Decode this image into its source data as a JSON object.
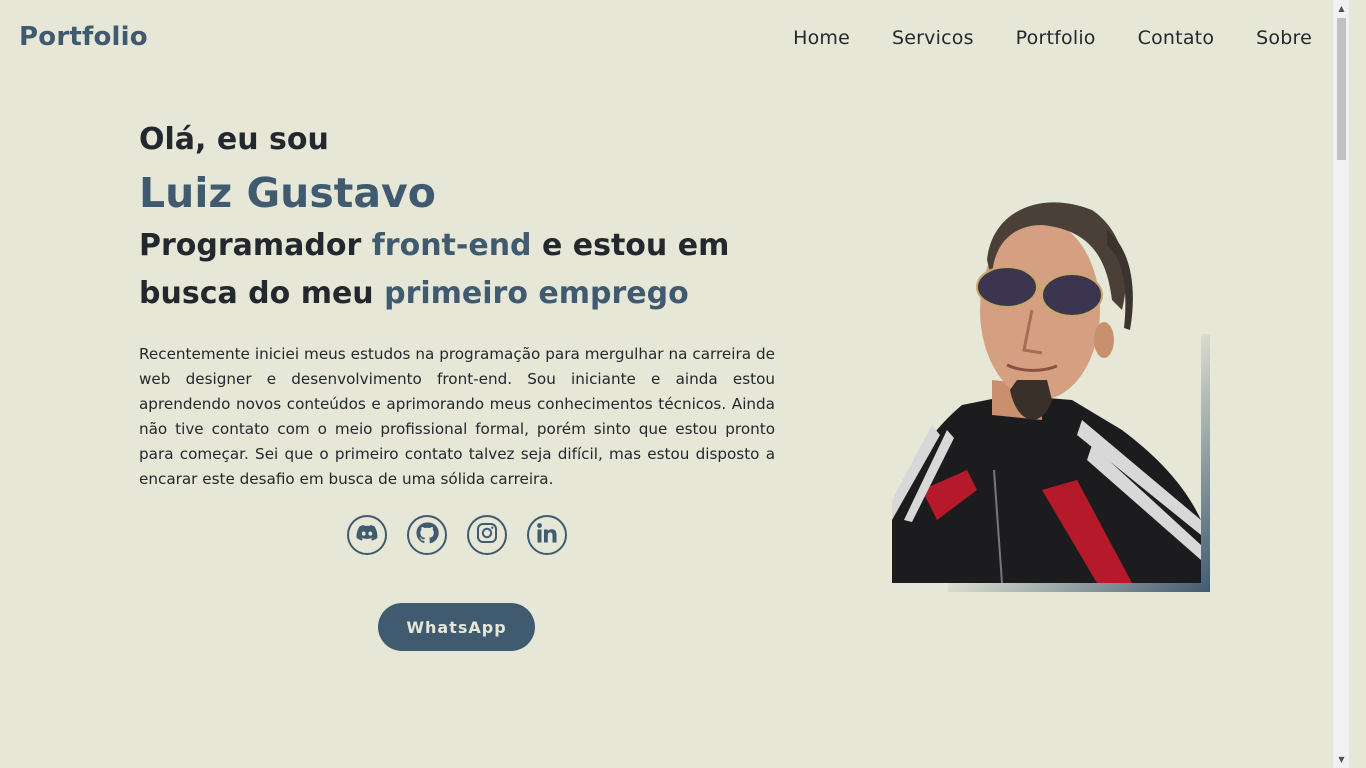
{
  "header": {
    "logo": "Portfolio",
    "nav": [
      "Home",
      "Servicos",
      "Portfolio",
      "Contato",
      "Sobre"
    ]
  },
  "hero": {
    "greeting": "Olá, eu sou",
    "name": "Luiz Gustavo",
    "role_part1": "Programador ",
    "role_accent1": "front-end",
    "role_part2": " e estou em busca do meu ",
    "role_accent2": "primeiro emprego",
    "bio": "Recentemente iniciei meus estudos na programação para mergulhar na carreira de web designer e desenvolvimento front-end. Sou iniciante e ainda estou aprendendo novos conteúdos e aprimorando meus conhecimentos técnicos. Ainda não tive contato com o meio profissional formal, porém sinto que estou pronto para começar. Sei que o primeiro contato talvez seja difícil, mas estou disposto a encarar este desafio em busca de uma sólida carreira."
  },
  "socials": [
    {
      "icon": "discord-icon"
    },
    {
      "icon": "github-icon"
    },
    {
      "icon": "instagram-icon"
    },
    {
      "icon": "linkedin-icon"
    }
  ],
  "cta": {
    "whatsapp_label": "WhatsApp"
  },
  "colors": {
    "background": "#e6e7d7",
    "accent": "#405a70",
    "text": "#23282f"
  }
}
